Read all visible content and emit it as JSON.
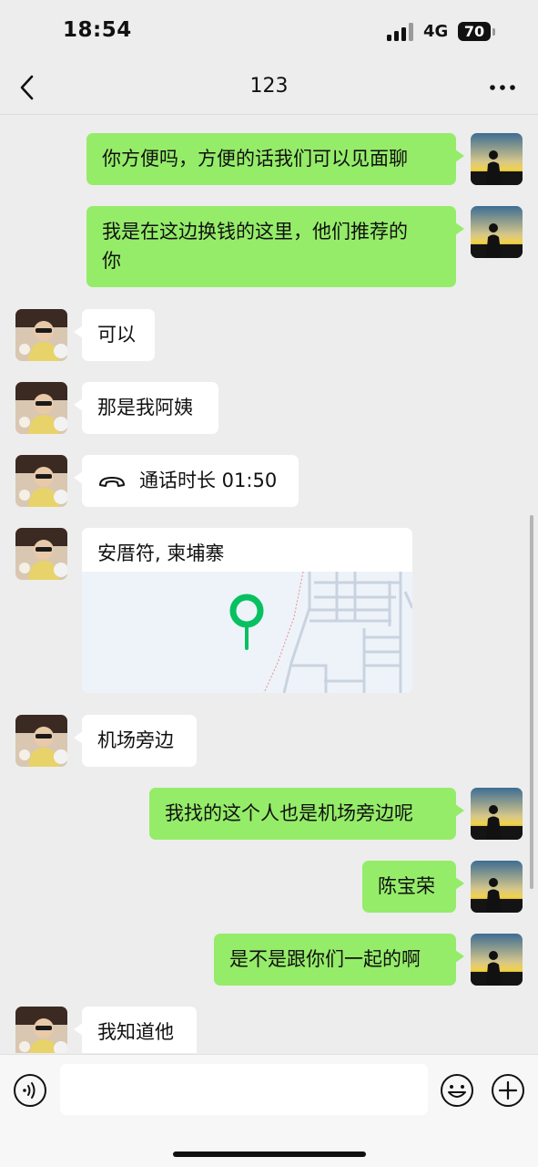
{
  "status_bar": {
    "time": "18:54",
    "network": "4G",
    "battery": "70"
  },
  "header": {
    "title": "123"
  },
  "messages": [
    {
      "side": "me",
      "text": "你方便吗，方便的话我们可以见面聊"
    },
    {
      "side": "me",
      "text_line1": "我是在这边换钱的这里，他们推荐的",
      "text_line2": "你"
    },
    {
      "side": "them",
      "text": "可以"
    },
    {
      "side": "them",
      "text": "那是我阿姨"
    },
    {
      "side": "them",
      "type": "call",
      "text": "通话时长 01:50"
    },
    {
      "side": "them",
      "type": "location",
      "text": "安厝符, 柬埔寨"
    },
    {
      "side": "them",
      "text": "机场旁边"
    },
    {
      "side": "me",
      "text": "我找的这个人也是机场旁边呢"
    },
    {
      "side": "me",
      "text": "陈宝荣"
    },
    {
      "side": "me",
      "text": "是不是跟你们一起的啊"
    },
    {
      "side": "them",
      "text": "我知道他"
    }
  ],
  "input": {
    "value": ""
  },
  "colors": {
    "sent_bubble": "#95ec69",
    "received_bubble": "#ffffff",
    "background": "#ededed",
    "map_pin": "#07c160"
  }
}
